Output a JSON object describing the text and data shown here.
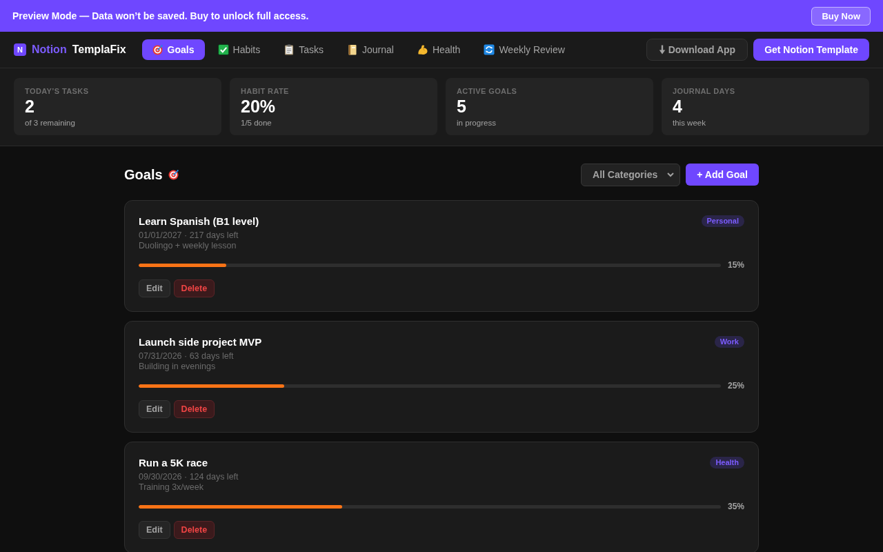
{
  "banner": {
    "message": "Preview Mode — Data won’t be saved. Buy to unlock full access.",
    "button": "Buy Now"
  },
  "nav": {
    "logo": {
      "mark": "N",
      "name": "Notion",
      "suffix": "TemplaFix"
    },
    "tabs": [
      {
        "label": "Goals",
        "selected": true
      },
      {
        "label": "Habits",
        "selected": false
      },
      {
        "label": "Tasks",
        "selected": false
      },
      {
        "label": "Journal",
        "selected": false
      },
      {
        "label": "Health",
        "selected": false
      },
      {
        "label": "Weekly Review",
        "selected": false
      }
    ],
    "actions": [
      {
        "label": "Download App",
        "kind": "secondary"
      },
      {
        "label": "Get Notion Template",
        "kind": "primary"
      }
    ]
  },
  "stats": [
    {
      "label": "TODAY’S TASKS",
      "value": "2",
      "caption": "of 3 remaining"
    },
    {
      "label": "HABIT RATE",
      "value": "20%",
      "caption": "1/5 done"
    },
    {
      "label": "ACTIVE GOALS",
      "value": "5",
      "caption": "in progress"
    },
    {
      "label": "JOURNAL DAYS",
      "value": "4",
      "caption": "this week"
    }
  ],
  "goals": {
    "title": "Goals",
    "filter": "All Categories",
    "add_button": "+ Add Goal",
    "items": [
      {
        "title": "Learn Spanish (B1 level)",
        "due": "01/01/2027 · 217 days left",
        "note": "Duolingo + weekly lesson",
        "category": "Personal",
        "level": 0.15,
        "reading": "15%",
        "actions": [
          {
            "label": "Edit",
            "kind": "edit"
          },
          {
            "label": "Delete",
            "kind": "delete"
          }
        ]
      },
      {
        "title": "Launch side project MVP",
        "due": "07/31/2026 · 63 days left",
        "note": "Building in evenings",
        "category": "Work",
        "level": 0.25,
        "reading": "25%",
        "actions": [
          {
            "label": "Edit",
            "kind": "edit"
          },
          {
            "label": "Delete",
            "kind": "delete"
          }
        ]
      },
      {
        "title": "Run a 5K race",
        "due": "09/30/2026 · 124 days left",
        "note": "Training 3x/week",
        "category": "Health",
        "level": 0.35,
        "reading": "35%",
        "actions": [
          {
            "label": "Edit",
            "kind": "edit"
          },
          {
            "label": "Delete",
            "kind": "delete"
          }
        ]
      }
    ]
  }
}
